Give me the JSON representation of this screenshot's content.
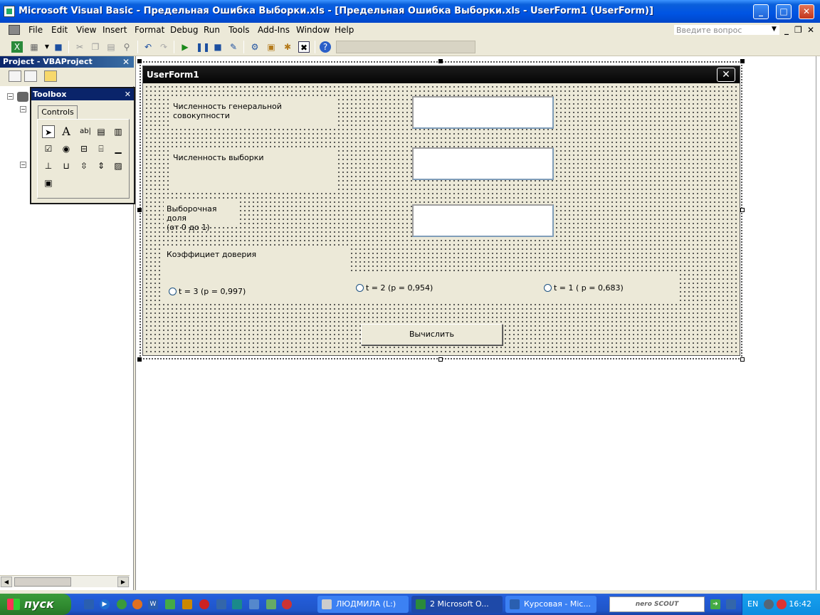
{
  "window": {
    "title": "Microsoft Visual Basic - Предельная Ошибка Выборки.xls - [Предельная Ошибка Выборки.xls - UserForm1 (UserForm)]",
    "minimize": "_",
    "maximize": "□",
    "close": "✕"
  },
  "menu": {
    "items": [
      "File",
      "Edit",
      "View",
      "Insert",
      "Format",
      "Debug",
      "Run",
      "Tools",
      "Add-Ins",
      "Window",
      "Help"
    ],
    "ask_placeholder": "Введите вопрос",
    "mdi_min": "_",
    "mdi_restore": "❐",
    "mdi_close": "✕"
  },
  "project": {
    "title": "Project - VBAProject",
    "close": "✕"
  },
  "toolbox": {
    "title": "Toolbox",
    "close": "✕",
    "tab": "Controls",
    "tools": [
      "pointer",
      "label",
      "textbox",
      "combobox",
      "listbox",
      "checkbox",
      "optionbutton",
      "togglebutton",
      "frame",
      "commandbutton",
      "tabstrip",
      "multipage",
      "scrollbar",
      "spinbutton",
      "image",
      "refedit"
    ],
    "label_glyph": "A",
    "textbox_glyph": "ab|"
  },
  "userform": {
    "title": "UserForm1",
    "close": "✕",
    "label_population": "Численность генеральной совокупности",
    "label_sample": "Численность выборки",
    "label_share_line1": "Выборочная доля",
    "label_share_line2": "(от 0 до 1)",
    "label_confidence": "Коэффициет доверия",
    "option1": "t = 3 (p = 0,997)",
    "option2": "t = 2 (p = 0,954)",
    "option3": "t = 1 ( p = 0,683)",
    "button_calc": "Вычислить"
  },
  "taskbar": {
    "start": "пуск",
    "tasks": [
      {
        "label": "ЛЮДМИЛА (L:)",
        "active": false
      },
      {
        "label": "2 Microsoft O...",
        "active": true
      },
      {
        "label": "Курсовая - Mic...",
        "active": false
      }
    ],
    "nero": "nero SCOUT",
    "lang": "EN",
    "clock": "16:42"
  }
}
